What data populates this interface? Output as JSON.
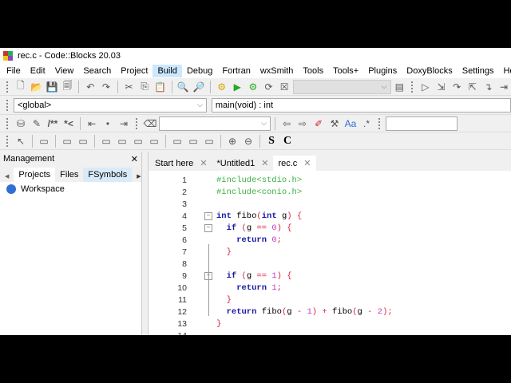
{
  "window": {
    "title": "rec.c - Code::Blocks 20.03"
  },
  "menu": [
    "File",
    "Edit",
    "View",
    "Search",
    "Project",
    "Build",
    "Debug",
    "Fortran",
    "wxSmith",
    "Tools",
    "Tools+",
    "Plugins",
    "DoxyBlocks",
    "Settings",
    "Help"
  ],
  "menu_hover": "Build",
  "toolbar_scope": {
    "scope": "<global>",
    "function": "main(void) : int"
  },
  "toolbar_icons": {
    "row1": [
      "new-file-icon",
      "open-icon",
      "save-icon",
      "save-all-icon",
      "undo-icon",
      "redo-icon",
      "cut-icon",
      "copy-icon",
      "paste-icon",
      "find-icon",
      "replace-icon",
      "build-icon",
      "run-icon",
      "build-run-icon",
      "rebuild-icon",
      "abort-icon"
    ],
    "row1_right": [
      "build-log-icon",
      "debug-run-icon",
      "step-into-icon",
      "step-over-icon",
      "step-out-icon",
      "next-line-icon",
      "next-instruction-icon"
    ],
    "row3": [
      "comment-block-icon",
      "doc-icon",
      "prev-bookmark-icon",
      "bookmark-icon",
      "next-bookmark-icon",
      "clear-icon",
      "back-icon",
      "forward-icon",
      "highlight-icon",
      "tool-icon",
      "match-case-icon",
      "regex-icon"
    ],
    "row3_labels": {
      "doxy1": "/**",
      "doxy2": "*<"
    },
    "row4_labels": {
      "s": "S",
      "c": "C"
    }
  },
  "management": {
    "title": "Management",
    "tabs": [
      "Projects",
      "Files",
      "FSymbols"
    ],
    "active_tab": "Projects",
    "tree": [
      "Workspace"
    ]
  },
  "editor": {
    "tabs": [
      {
        "label": "Start here"
      },
      {
        "label": "*Untitled1"
      },
      {
        "label": "rec.c"
      }
    ],
    "active_tab": "rec.c",
    "lines": [
      [
        [
          "#include<stdio.h>",
          "pp"
        ]
      ],
      [
        [
          "#include<conio.h>",
          "pp"
        ]
      ],
      [],
      [
        [
          "int",
          "kw"
        ],
        [
          " fibo",
          "id"
        ],
        [
          "(",
          "op"
        ],
        [
          "int",
          "kw"
        ],
        [
          " g",
          "id"
        ],
        [
          ")",
          "op"
        ],
        [
          " {",
          "op"
        ]
      ],
      [
        [
          "  if",
          "kw"
        ],
        [
          " (",
          "op"
        ],
        [
          "g ",
          "id"
        ],
        [
          "==",
          "op"
        ],
        [
          " 0",
          "nm"
        ],
        [
          ")",
          "op"
        ],
        [
          " {",
          "op"
        ]
      ],
      [
        [
          "    return",
          "kw"
        ],
        [
          " 0",
          "nm"
        ],
        [
          ";",
          "op"
        ]
      ],
      [
        [
          "  }",
          "op"
        ]
      ],
      [],
      [
        [
          "  if",
          "kw"
        ],
        [
          " (",
          "op"
        ],
        [
          "g ",
          "id"
        ],
        [
          "==",
          "op"
        ],
        [
          " 1",
          "nm"
        ],
        [
          ")",
          "op"
        ],
        [
          " {",
          "op"
        ]
      ],
      [
        [
          "    return",
          "kw"
        ],
        [
          " 1",
          "nm"
        ],
        [
          ";",
          "op"
        ]
      ],
      [
        [
          "  }",
          "op"
        ]
      ],
      [
        [
          "  return",
          "kw"
        ],
        [
          " fibo",
          "id"
        ],
        [
          "(",
          "op"
        ],
        [
          "g ",
          "id"
        ],
        [
          "-",
          "op"
        ],
        [
          " 1",
          "nm"
        ],
        [
          ")",
          "op"
        ],
        [
          " +",
          "op"
        ],
        [
          " fibo",
          "id"
        ],
        [
          "(",
          "op"
        ],
        [
          "g ",
          "id"
        ],
        [
          "-",
          "op"
        ],
        [
          " 2",
          "nm"
        ],
        [
          ");",
          "op"
        ]
      ],
      [
        [
          "}",
          "op"
        ]
      ],
      []
    ]
  }
}
